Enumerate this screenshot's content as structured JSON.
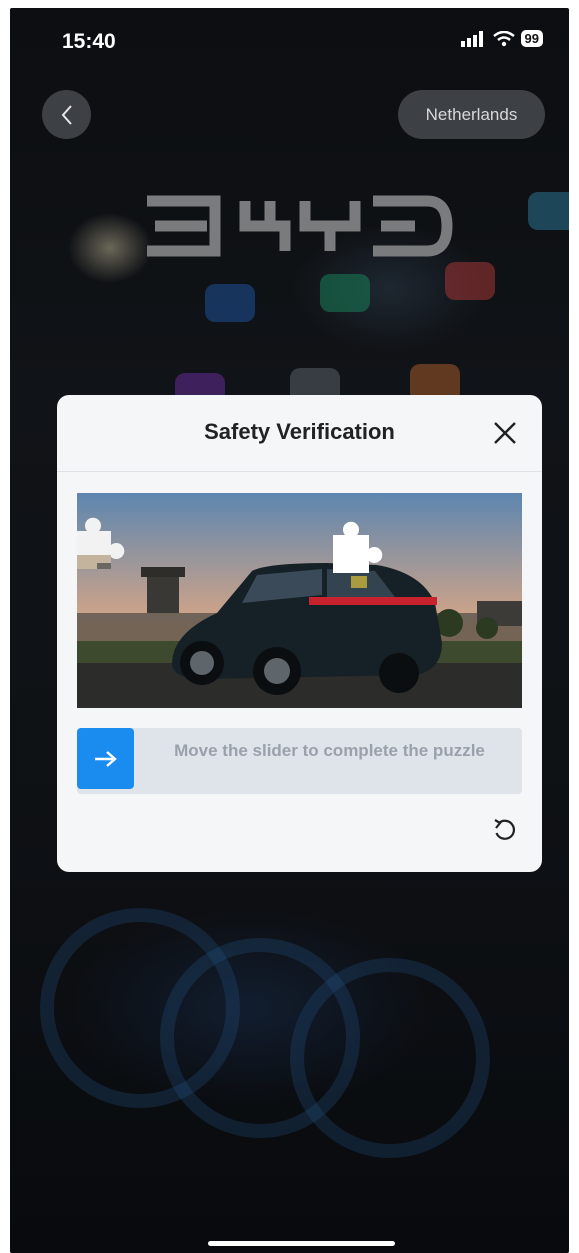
{
  "status_bar": {
    "time": "15:40",
    "battery": "99"
  },
  "header": {
    "region_label": "Netherlands"
  },
  "brand": {
    "logo_text": "BYD"
  },
  "dialog": {
    "title": "Safety Verification",
    "slider_hint": "Move the slider to complete the puzzle",
    "slider_progress": 0
  },
  "colors": {
    "accent": "#1a8cf0",
    "dialog_bg": "#f5f6f8",
    "slider_track": "#dfe3ea",
    "hint_text": "#9aa1ab"
  },
  "icons": {
    "back": "chevron-left-icon",
    "close": "close-icon",
    "slider": "arrow-right-icon",
    "refresh": "refresh-icon",
    "signal": "signal-icon",
    "wifi": "wifi-icon"
  }
}
